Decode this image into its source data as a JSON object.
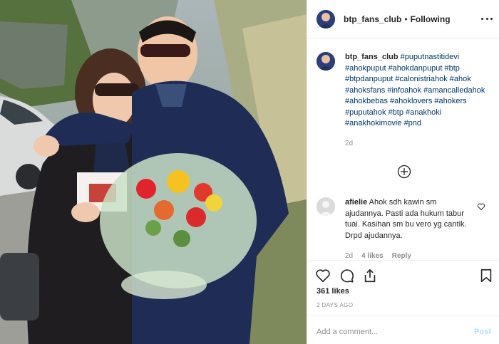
{
  "post": {
    "username": "btp_fans_club",
    "separator": "•",
    "follow_status": "Following",
    "photo_description_icon": "post-photo"
  },
  "caption": {
    "username": "btp_fans_club",
    "hashtags": [
      "#puputnastitidevi",
      "#ahokpuput",
      "#ahokdanpuput",
      "#btp",
      "#btpdanpuput",
      "#calonistriahok",
      "#ahok",
      "#ahoksfans",
      "#infoahok",
      "#amancalledahok",
      "#ahokbebas",
      "#ahoklovers",
      "#ahokers",
      "#puputahok",
      "#btp",
      "#anakhoki",
      "#anakhokimovie",
      "#pnd"
    ],
    "time": "2d"
  },
  "comments": [
    {
      "username": "afielie",
      "text": "Ahok sdh kawin sm ajudannya. Pasti ada hukum tabur tuai. Kasihan sm bu vero yg cantik. Drpd ajudannya.",
      "time": "2d",
      "likes": "4 likes",
      "reply": "Reply"
    }
  ],
  "stats": {
    "likes": "361 likes",
    "posted": "2 DAYS AGO"
  },
  "add_comment": {
    "placeholder": "Add a comment...",
    "post_label": "Post"
  },
  "colors": {
    "hashtag": "#00376b",
    "muted": "#8e8e8e",
    "post_disabled": "#b2dffc"
  }
}
